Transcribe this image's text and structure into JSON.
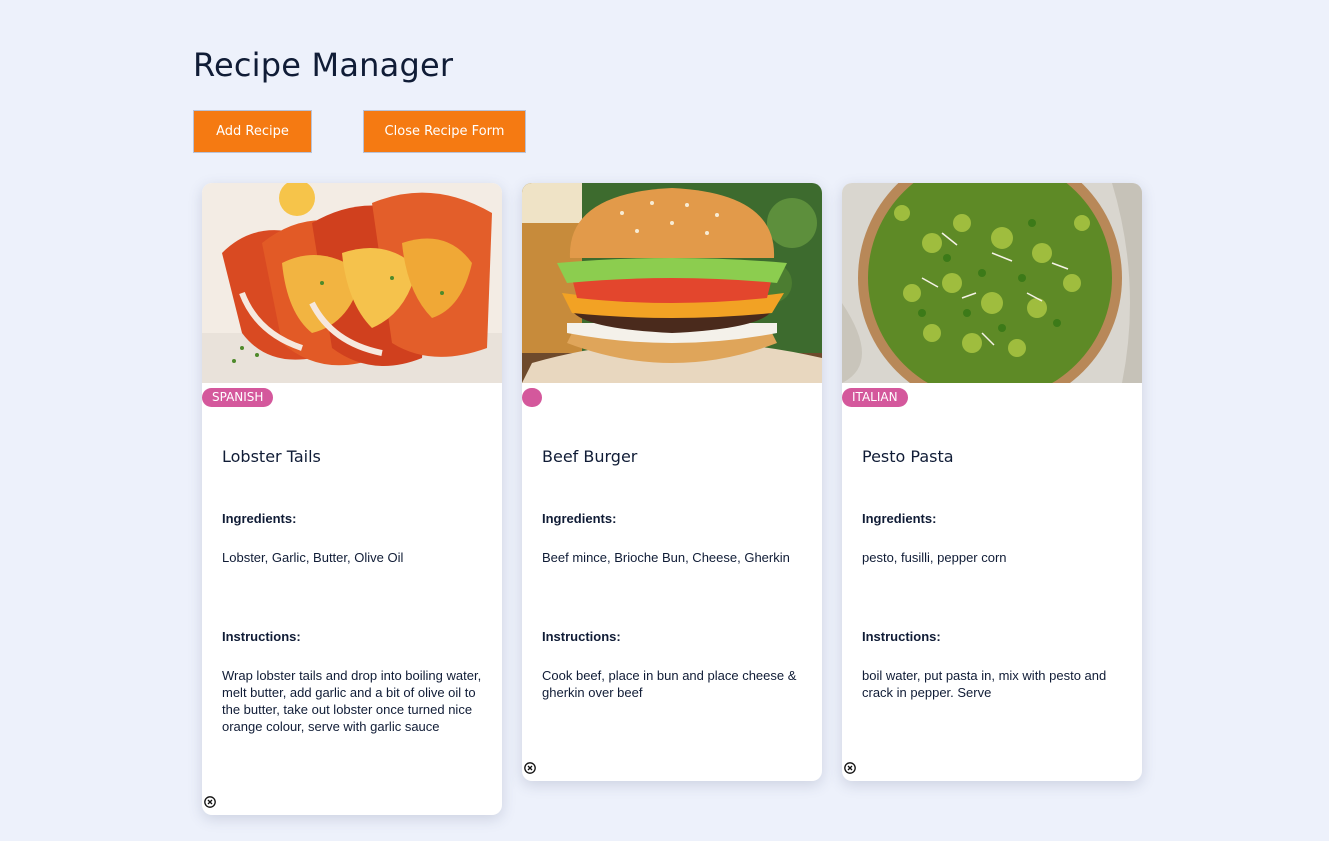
{
  "page": {
    "title": "Recipe Manager"
  },
  "toolbar": {
    "add_label": "Add Recipe",
    "close_label": "Close Recipe Form"
  },
  "colors": {
    "background": "#edf1fb",
    "button": "#f57a12",
    "badge": "#d4589c"
  },
  "recipes": [
    {
      "name": "Lobster Tails",
      "cuisine": "SPANISH",
      "image": "lobster-tails-photo",
      "ingredients_label": "Ingredients:",
      "ingredients": "Lobster, Garlic, Butter, Olive Oil",
      "instructions_label": "Instructions:",
      "instructions": "Wrap lobster tails and drop into boiling water, melt butter, add garlic and a bit of olive oil to the butter, take out lobster once turned nice orange colour, serve with garlic sauce",
      "delete_icon": "close-circle-icon"
    },
    {
      "name": "Beef Burger",
      "cuisine": "",
      "image": "beef-burger-photo",
      "ingredients_label": "Ingredients:",
      "ingredients": "Beef mince, Brioche Bun, Cheese, Gherkin",
      "instructions_label": "Instructions:",
      "instructions": "Cook beef, place in bun and place cheese & gherkin over beef",
      "delete_icon": "close-circle-icon"
    },
    {
      "name": "Pesto Pasta",
      "cuisine": "ITALIAN",
      "image": "pesto-pasta-photo",
      "ingredients_label": "Ingredients:",
      "ingredients": "pesto, fusilli, pepper corn",
      "instructions_label": "Instructions:",
      "instructions": "boil water, put pasta in, mix with pesto and crack in pepper. Serve",
      "delete_icon": "close-circle-icon"
    }
  ]
}
